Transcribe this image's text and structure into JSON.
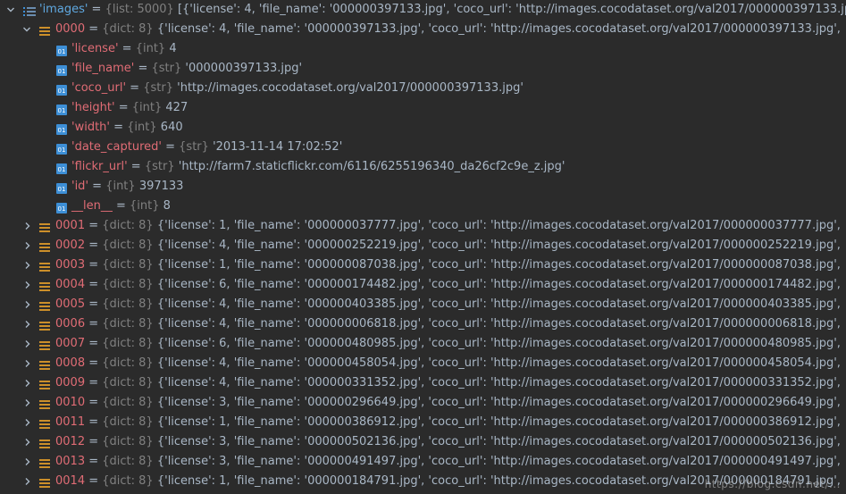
{
  "root": {
    "name": "'images'",
    "type": "{list: 5000}",
    "preview": "[{'license': 4, 'file_name': '000000397133.jpg', 'coco_url': 'http://images.cocodataset.org/val2017/000000397133.jpg',"
  },
  "expanded": {
    "index": "0000",
    "type": "{dict: 8}",
    "preview": "{'license': 4, 'file_name': '000000397133.jpg', 'coco_url': 'http://images.cocodataset.org/val2017/000000397133.jpg',",
    "fields": [
      {
        "name": "'license'",
        "type": "{int}",
        "value": "4"
      },
      {
        "name": "'file_name'",
        "type": "{str}",
        "value": "'000000397133.jpg'"
      },
      {
        "name": "'coco_url'",
        "type": "{str}",
        "value": "'http://images.cocodataset.org/val2017/000000397133.jpg'"
      },
      {
        "name": "'height'",
        "type": "{int}",
        "value": "427"
      },
      {
        "name": "'width'",
        "type": "{int}",
        "value": "640"
      },
      {
        "name": "'date_captured'",
        "type": "{str}",
        "value": "'2013-11-14 17:02:52'"
      },
      {
        "name": "'flickr_url'",
        "type": "{str}",
        "value": "'http://farm7.staticflickr.com/6116/6255196340_da26cf2c9e_z.jpg'"
      },
      {
        "name": "'id'",
        "type": "{int}",
        "value": "397133"
      },
      {
        "name": "__len__",
        "type": "{int}",
        "value": "8"
      }
    ]
  },
  "collapsed": [
    {
      "index": "0001",
      "type": "{dict: 8}",
      "preview": "{'license': 1, 'file_name': '000000037777.jpg', 'coco_url': 'http://images.cocodataset.org/val2017/000000037777.jpg',"
    },
    {
      "index": "0002",
      "type": "{dict: 8}",
      "preview": "{'license': 4, 'file_name': '000000252219.jpg', 'coco_url': 'http://images.cocodataset.org/val2017/000000252219.jpg',"
    },
    {
      "index": "0003",
      "type": "{dict: 8}",
      "preview": "{'license': 1, 'file_name': '000000087038.jpg', 'coco_url': 'http://images.cocodataset.org/val2017/000000087038.jpg',"
    },
    {
      "index": "0004",
      "type": "{dict: 8}",
      "preview": "{'license': 6, 'file_name': '000000174482.jpg', 'coco_url': 'http://images.cocodataset.org/val2017/000000174482.jpg',"
    },
    {
      "index": "0005",
      "type": "{dict: 8}",
      "preview": "{'license': 4, 'file_name': '000000403385.jpg', 'coco_url': 'http://images.cocodataset.org/val2017/000000403385.jpg',"
    },
    {
      "index": "0006",
      "type": "{dict: 8}",
      "preview": "{'license': 4, 'file_name': '000000006818.jpg', 'coco_url': 'http://images.cocodataset.org/val2017/000000006818.jpg',"
    },
    {
      "index": "0007",
      "type": "{dict: 8}",
      "preview": "{'license': 6, 'file_name': '000000480985.jpg', 'coco_url': 'http://images.cocodataset.org/val2017/000000480985.jpg',"
    },
    {
      "index": "0008",
      "type": "{dict: 8}",
      "preview": "{'license': 4, 'file_name': '000000458054.jpg', 'coco_url': 'http://images.cocodataset.org/val2017/000000458054.jpg',"
    },
    {
      "index": "0009",
      "type": "{dict: 8}",
      "preview": "{'license': 4, 'file_name': '000000331352.jpg', 'coco_url': 'http://images.cocodataset.org/val2017/000000331352.jpg',"
    },
    {
      "index": "0010",
      "type": "{dict: 8}",
      "preview": "{'license': 3, 'file_name': '000000296649.jpg', 'coco_url': 'http://images.cocodataset.org/val2017/000000296649.jpg',"
    },
    {
      "index": "0011",
      "type": "{dict: 8}",
      "preview": "{'license': 1, 'file_name': '000000386912.jpg', 'coco_url': 'http://images.cocodataset.org/val2017/000000386912.jpg',"
    },
    {
      "index": "0012",
      "type": "{dict: 8}",
      "preview": "{'license': 3, 'file_name': '000000502136.jpg', 'coco_url': 'http://images.cocodataset.org/val2017/000000502136.jpg',"
    },
    {
      "index": "0013",
      "type": "{dict: 8}",
      "preview": "{'license': 3, 'file_name': '000000491497.jpg', 'coco_url': 'http://images.cocodataset.org/val2017/000000491497.jpg',"
    },
    {
      "index": "0014",
      "type": "{dict: 8}",
      "preview": "{'license': 1, 'file_name': '000000184791.jpg', 'coco_url': 'http://images.cocodataset.org/val2017/000000184791.jpg',"
    }
  ],
  "icons": {
    "expanded_chevron": "chevron-down-icon",
    "collapsed_chevron": "chevron-right-icon",
    "list_icon": "list-icon",
    "dict_icon": "dict-icon",
    "field_icon": "field-icon"
  },
  "colors": {
    "background": "#2b2b2b",
    "name": "#e06c75",
    "type": "#808080",
    "text": "#a9b7c6",
    "dict_icon": "#cc8f2a",
    "field_icon": "#3d8fd6"
  }
}
